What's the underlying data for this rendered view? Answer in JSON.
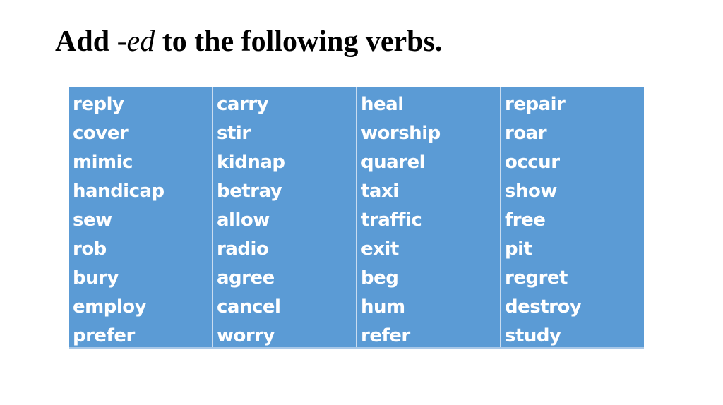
{
  "title": {
    "prefix": "Add ",
    "emphasis": "-ed",
    "suffix": " to the following verbs."
  },
  "colors": {
    "table_fill": "#5b9bd5",
    "word_text": "#ffffff",
    "title_text": "#000000"
  },
  "table": {
    "columns": [
      {
        "words": [
          "reply",
          "cover",
          "mimic",
          "handicap",
          "sew",
          "rob",
          "bury",
          "employ",
          "prefer"
        ]
      },
      {
        "words": [
          "carry",
          "stir",
          "kidnap",
          "betray",
          "allow",
          "radio",
          "agree",
          "cancel",
          "worry"
        ]
      },
      {
        "words": [
          "heal",
          "worship",
          "quarel",
          "taxi",
          "traffic",
          "exit",
          "beg",
          "hum",
          "refer"
        ]
      },
      {
        "words": [
          "repair",
          "roar",
          "occur",
          "show",
          "free",
          "pit",
          "regret",
          "destroy",
          "study"
        ]
      }
    ]
  }
}
